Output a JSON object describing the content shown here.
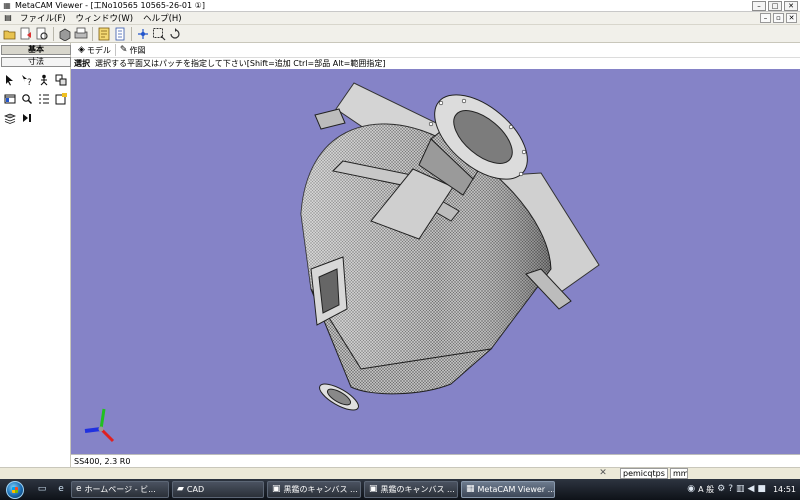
{
  "window": {
    "app_icon": "metacam-app-icon",
    "title": "MetaCAM Viewer - [工No10565 10565-26-01 ①]",
    "buttons": [
      "–",
      "□",
      "✕"
    ]
  },
  "menubar": {
    "items": [
      "ファイル(F)",
      "ウィンドウ(W)",
      "ヘルプ(H)"
    ],
    "mdi_buttons": [
      "–",
      "▫",
      "✕"
    ]
  },
  "toolbar": {
    "icons": [
      "open-folder-icon",
      "import-icon",
      "print-preview-icon",
      "3d-model-icon",
      "print-icon",
      "properties-icon",
      "notes-icon",
      "axis-icon",
      "zoom-window-icon",
      "rotate-icon"
    ]
  },
  "left_panel": {
    "tabs": [
      "基本",
      "寸法"
    ],
    "tools": [
      "select-arrow-icon",
      "query-icon",
      "person-icon",
      "parts-icon",
      "view-list-icon",
      "magnify-icon",
      "grid-icon",
      "note-icon",
      "layers-icon",
      "play-icon"
    ]
  },
  "view_tabs": [
    {
      "label": "モデル",
      "icon": "model-cube-icon"
    },
    {
      "label": "作図",
      "icon": "drawing-pencil-icon"
    }
  ],
  "prompt": {
    "mode": "選択",
    "message": "選択する平面又はパッチを指定して下さい[Shift=追加 Ctrl=部品 Alt=範囲指定]"
  },
  "viewport": {
    "background": "#8583c7",
    "model": "3d-hopper-model",
    "axis_colors": {
      "x": "#e02020",
      "y": "#20c020",
      "z": "#2030e0"
    }
  },
  "status": {
    "material": "SS400, 2.3 R0"
  },
  "lower_strip": {
    "field": "pemicqtps",
    "unit": "mm"
  },
  "taskbar": {
    "tasks": [
      {
        "label": "ホームページ - ビ...",
        "icon": "ie-icon"
      },
      {
        "label": "CAD",
        "icon": "folder-icon"
      },
      {
        "label": "黒鑑のキャンバス ...",
        "icon": "paint-icon"
      },
      {
        "label": "黒鑑のキャンバス ...",
        "icon": "paint-icon"
      },
      {
        "label": "MetaCAM Viewer ...",
        "icon": "metacam-app-icon",
        "active": true
      }
    ],
    "ime": "A 般",
    "clock": "14:51"
  }
}
